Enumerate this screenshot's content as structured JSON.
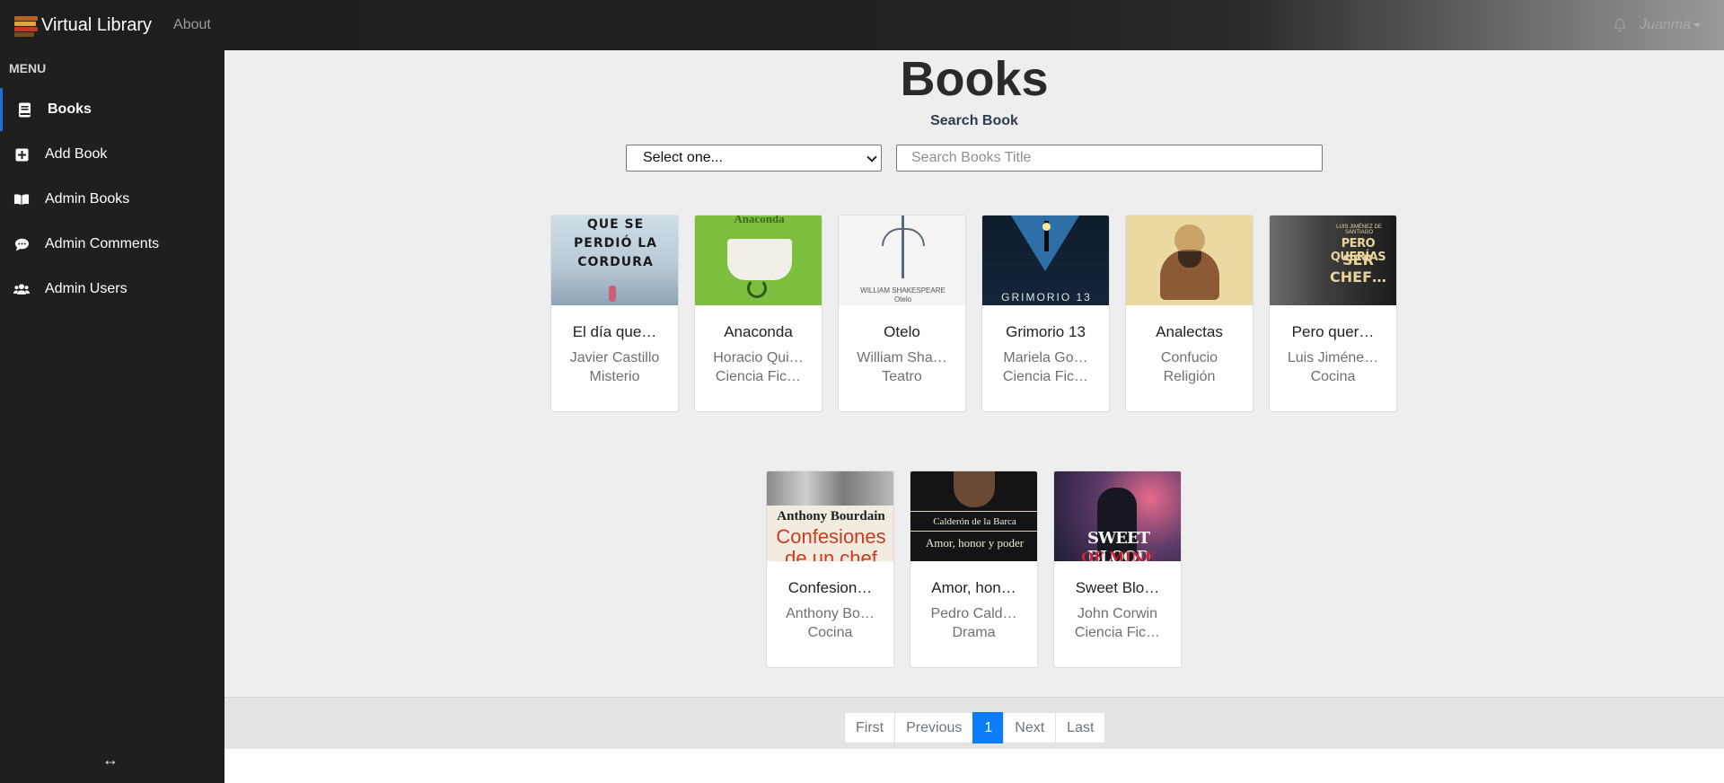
{
  "navbar": {
    "brand_title": "Virtual Library",
    "about_link": "About",
    "user_name": "Juanma",
    "icons": {
      "logo": "bookshelf-logo-icon",
      "notifications": "bell-icon",
      "user_menu": "caret-down-icon"
    }
  },
  "sidebar": {
    "menu_label": "MENU",
    "items": [
      {
        "label": "Books",
        "icon": "book-icon",
        "active": true
      },
      {
        "label": "Add Book",
        "icon": "plus-square-icon",
        "active": false
      },
      {
        "label": "Admin Books",
        "icon": "open-book-icon",
        "active": false
      },
      {
        "label": "Admin Comments",
        "icon": "comment-icon",
        "active": false
      },
      {
        "label": "Admin Users",
        "icon": "users-icon",
        "active": false
      }
    ],
    "collapse_icon": "↔"
  },
  "main": {
    "title": "Books",
    "search_label": "Search Book",
    "filter_select_value": "Select one...",
    "search_placeholder": "Search Books Title"
  },
  "books": [
    {
      "title": "El día que…",
      "author": "Javier Castillo",
      "genre": "Misterio",
      "cover_text": [
        "QUE SE",
        "PERDIÓ LA",
        "CORDURA"
      ]
    },
    {
      "title": "Anaconda",
      "author": "Horacio Qui…",
      "genre": "Ciencia Fic…",
      "cover_text": [
        "Anaconda"
      ]
    },
    {
      "title": "Otelo",
      "author": "William Sha…",
      "genre": "Teatro",
      "cover_text": [
        "WILLIAM SHAKESPEARE",
        "Otelo"
      ]
    },
    {
      "title": "Grimorio 13",
      "author": "Mariela Go…",
      "genre": "Ciencia Fic…",
      "cover_text": [
        "GRIMORIO 13"
      ]
    },
    {
      "title": "Analectas",
      "author": "Confucio",
      "genre": "Religión",
      "cover_text": []
    },
    {
      "title": "Pero quer…",
      "author": "Luis Jiméne…",
      "genre": "Cocina",
      "cover_text": [
        "LUIS JIMÉNEZ DE SANTIAGO",
        "PERO QUERÍAS",
        "SER CHEF…"
      ]
    },
    {
      "title": "Confesion…",
      "author": "Anthony Bo…",
      "genre": "Cocina",
      "cover_text": [
        "Anthony Bourdain",
        "Confesiones",
        "de un chef"
      ]
    },
    {
      "title": "Amor, hon…",
      "author": "Pedro Cald…",
      "genre": "Drama",
      "cover_text": [
        "Calderón de la Barca",
        "Amor, honor y poder"
      ]
    },
    {
      "title": "Sweet Blo…",
      "author": "John Corwin",
      "genre": "Ciencia Fic…",
      "cover_text": [
        "SWEET BLOOD",
        "OF MINE"
      ]
    }
  ],
  "pagination": {
    "first": "First",
    "previous": "Previous",
    "current": "1",
    "next": "Next",
    "last": "Last"
  },
  "colors": {
    "accent": "#0d7bfd",
    "sidebar_bg": "#1f1f1f",
    "main_bg": "#eeeeee"
  }
}
